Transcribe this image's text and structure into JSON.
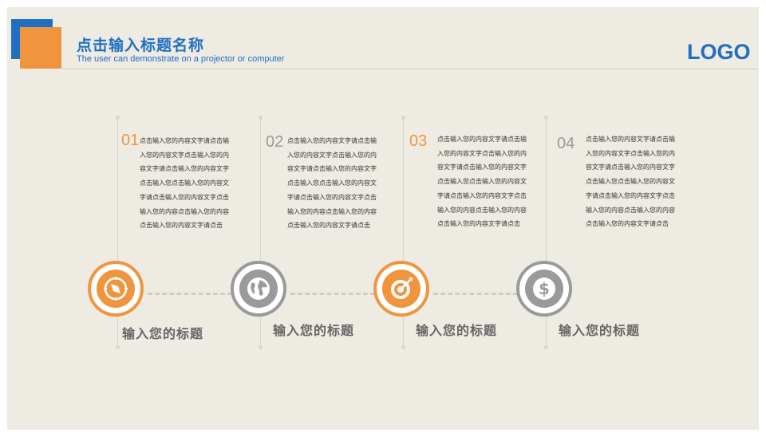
{
  "header": {
    "title": "点击输入标题名称",
    "subtitle": "The user can demonstrate on a projector or computer",
    "logo": "LOGO"
  },
  "colors": {
    "accent_blue": "#1f6fc4",
    "accent_orange": "#f0953e",
    "neutral_gray": "#9a9a9a",
    "background": "#eeebe3"
  },
  "steps": [
    {
      "number": "01",
      "body": "点击输入您的内容文字请点击输入您的内容文字点击输入您的内容文字请点击输入您的内容文字点击输入您点击输入您的内容文字请点击输入您的内容文字点击输入您的内容点击输入您的内容点击输入您的内容文字请点击",
      "icon": "compass-icon",
      "label": "输入您的标题"
    },
    {
      "number": "02",
      "body": "点击输入您的内容文字请点击输入您的内容文字点击输入您的内容文字请点击输入您的内容文字点击输入您点击输入您的内容文字请点击输入您的内容文字点击输入您的内容点击输入您的内容点击输入您的内容文字请点击",
      "icon": "globe-icon",
      "label": "输入您的标题"
    },
    {
      "number": "03",
      "body": "点击输入您的内容文字请点击输入您的内容文字点击输入您的内容文字请点击输入您的内容文字点击输入您点击输入您的内容文字请点击输入您的内容文字点击输入您的内容点击输入您的内容点击输入您的内容文字请点击",
      "icon": "target-icon",
      "label": "输入您的标题"
    },
    {
      "number": "04",
      "body": "点击输入您的内容文字请点击输入您的内容文字点击输入您的内容文字请点击输入您的内容文字点击输入您点击输入您的内容文字请点击输入您的内容文字点击输入您的内容点击输入您的内容点击输入您的内容文字请点击",
      "icon": "dollar-icon",
      "label": "输入您的标题"
    }
  ]
}
